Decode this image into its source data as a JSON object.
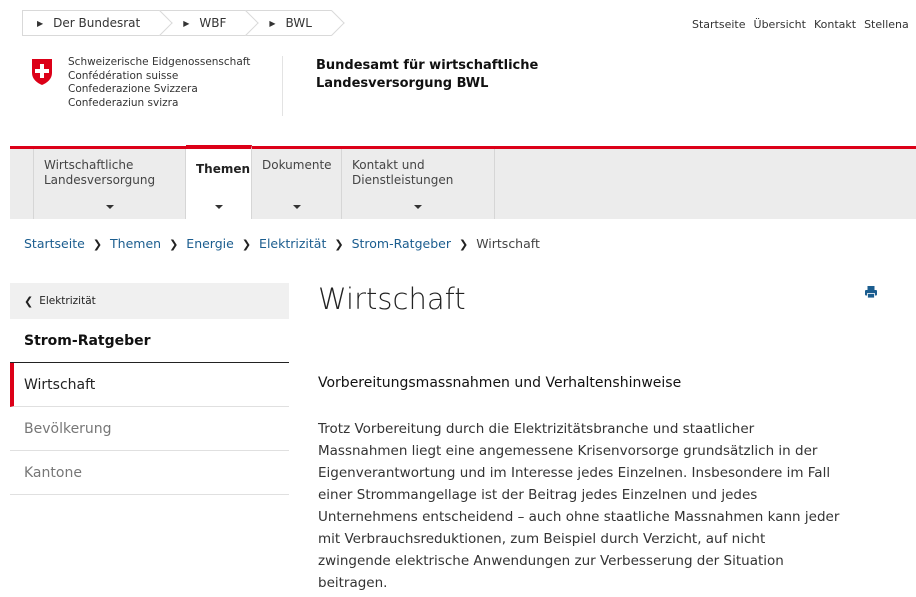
{
  "top_breadcrumbs": [
    "Der Bundesrat",
    "WBF",
    "BWL"
  ],
  "top_links": [
    "Startseite",
    "Übersicht",
    "Kontakt",
    "Stellena"
  ],
  "confederation": [
    "Schweizerische Eidgenossenschaft",
    "Confédération suisse",
    "Confederazione Svizzera",
    "Confederaziun svizra"
  ],
  "office": [
    "Bundesamt für wirtschaftliche",
    "Landesversorgung BWL"
  ],
  "nav": [
    {
      "line1": "Wirtschaftliche",
      "line2": "Landesversorgung"
    },
    {
      "line1": "Themen",
      "line2": ""
    },
    {
      "line1": "Dokumente",
      "line2": ""
    },
    {
      "line1": "Kontakt und",
      "line2": "Dienstleistungen"
    }
  ],
  "breadcrumbs": [
    "Startseite",
    "Themen",
    "Energie",
    "Elektrizität",
    "Strom-Ratgeber",
    "Wirtschaft"
  ],
  "sidebar": {
    "back": "Elektrizität",
    "heading": "Strom-Ratgeber",
    "items": [
      "Wirtschaft",
      "Bevölkerung",
      "Kantone"
    ]
  },
  "page": {
    "title": "Wirtschaft",
    "subheading": "Vorbereitungsmassnahmen und Verhaltenshinweise",
    "lines": [
      "Trotz Vorbereitung durch die Elektrizitätsbranche und staatlicher",
      "Massnahmen liegt eine angemessene Krisenvorsorge grundsätzlich in der",
      "Eigenverantwortung und im Interesse jedes Einzelnen. Insbesondere im Fall",
      "einer Strommangellage ist der Beitrag jedes Einzelnen und jedes",
      "Unternehmens entscheidend – auch ohne staatliche Massnahmen kann jeder",
      "mit Verbrauchsreduktionen, zum Beispiel durch Verzicht, auf nicht",
      "zwingende elektrische Anwendungen zur Verbesserung der Situation",
      "beitragen."
    ]
  },
  "colors": {
    "accent": "#dc0018",
    "link": "#1b5d8f",
    "nav_bg": "#ececec"
  },
  "icons": [
    "swiss-cross-icon",
    "print-icon",
    "chevron-left-icon",
    "caret-down-icon"
  ]
}
